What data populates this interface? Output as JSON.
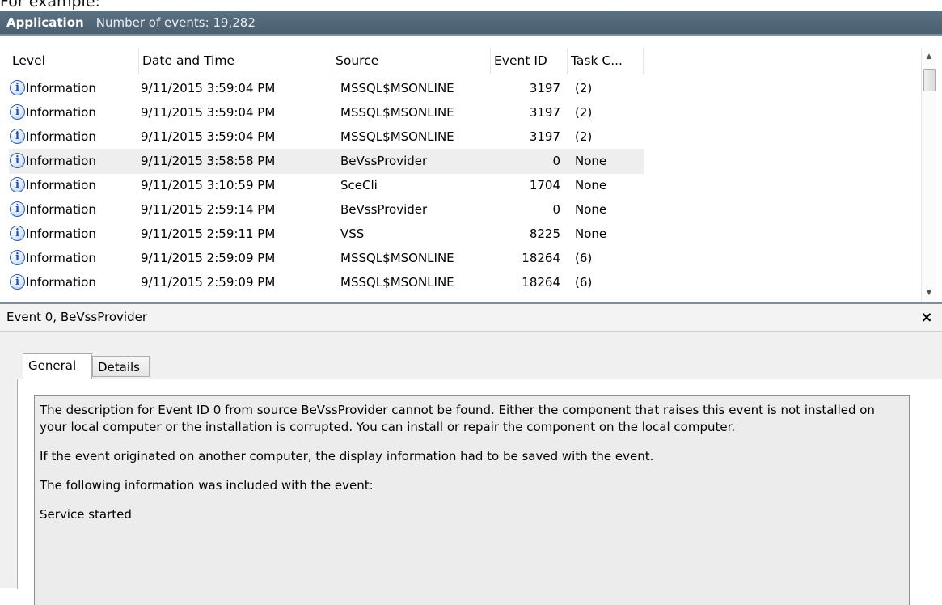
{
  "caption": "For example:",
  "log": {
    "name": "Application",
    "count_text": "Number of events: 19,282"
  },
  "columns": [
    "Level",
    "Date and Time",
    "Source",
    "Event ID",
    "Task C..."
  ],
  "rows": [
    {
      "level": "Information",
      "datetime": "9/11/2015 3:59:04 PM",
      "source": "MSSQL$MSONLINE",
      "event_id": "3197",
      "task": "(2)"
    },
    {
      "level": "Information",
      "datetime": "9/11/2015 3:59:04 PM",
      "source": "MSSQL$MSONLINE",
      "event_id": "3197",
      "task": "(2)"
    },
    {
      "level": "Information",
      "datetime": "9/11/2015 3:59:04 PM",
      "source": "MSSQL$MSONLINE",
      "event_id": "3197",
      "task": "(2)"
    },
    {
      "level": "Information",
      "datetime": "9/11/2015 3:58:58 PM",
      "source": "BeVssProvider",
      "event_id": "0",
      "task": "None",
      "selected": true
    },
    {
      "level": "Information",
      "datetime": "9/11/2015 3:10:59 PM",
      "source": "SceCli",
      "event_id": "1704",
      "task": "None"
    },
    {
      "level": "Information",
      "datetime": "9/11/2015 2:59:14 PM",
      "source": "BeVssProvider",
      "event_id": "0",
      "task": "None"
    },
    {
      "level": "Information",
      "datetime": "9/11/2015 2:59:11 PM",
      "source": "VSS",
      "event_id": "8225",
      "task": "None"
    },
    {
      "level": "Information",
      "datetime": "9/11/2015 2:59:09 PM",
      "source": "MSSQL$MSONLINE",
      "event_id": "18264",
      "task": "(6)"
    },
    {
      "level": "Information",
      "datetime": "9/11/2015 2:59:09 PM",
      "source": "MSSQL$MSONLINE",
      "event_id": "18264",
      "task": "(6)"
    }
  ],
  "icons": {
    "level": "information-icon",
    "close": "close-icon"
  },
  "detail": {
    "title": "Event 0, BeVssProvider",
    "close_glyph": "×",
    "tabs": [
      "General",
      "Details"
    ],
    "active_tab": "General",
    "description": [
      "The description for Event ID 0 from source BeVssProvider cannot be found. Either the component that raises this event is not installed on your local computer or the installation is corrupted. You can install or repair the component on the local computer.",
      "If the event originated on another computer, the display information had to be saved with the event.",
      "The following information was included with the event:",
      "Service started"
    ]
  },
  "colors": {
    "title_bar": "#4f6577",
    "selected_row": "#eeeeee",
    "info_icon": "#2052a8"
  }
}
